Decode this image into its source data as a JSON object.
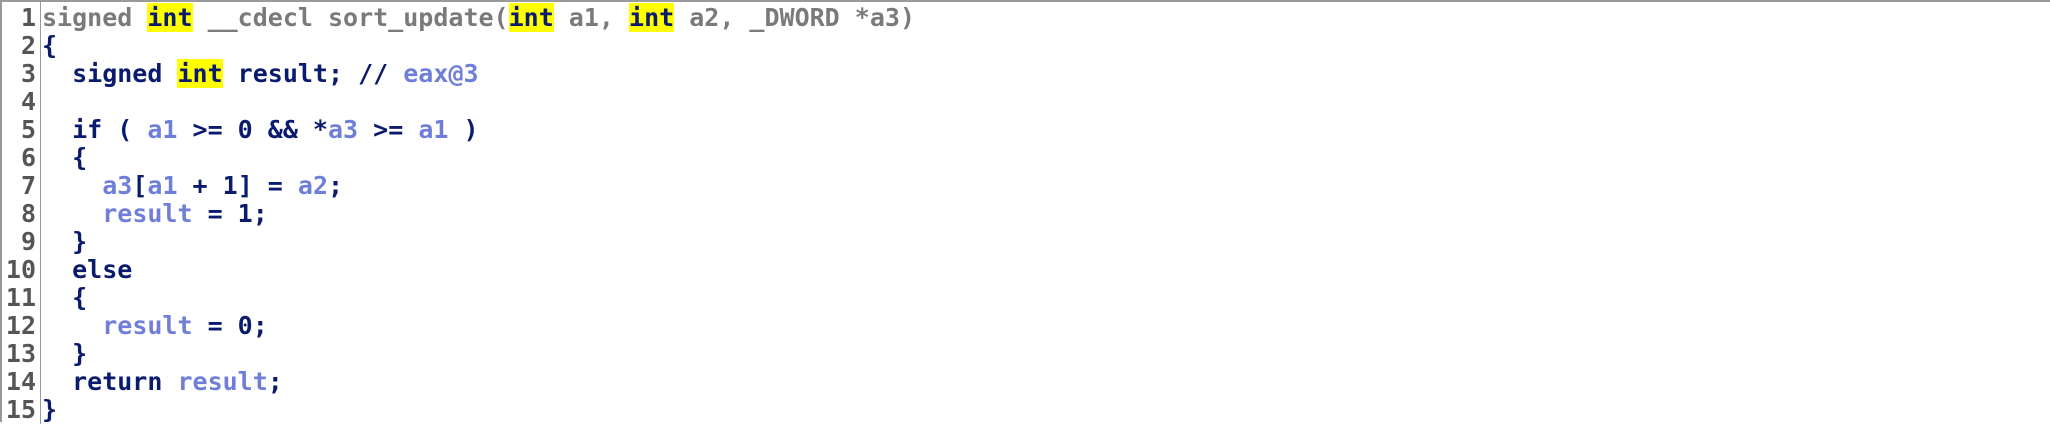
{
  "colors": {
    "background": "#ffffff",
    "line_number": "#555555",
    "keyword": "#0a1b6e",
    "variable": "#6f7fd9",
    "signature_text": "#7a7a7a",
    "highlight": "#ffff00"
  },
  "lines": [
    {
      "number": "1",
      "tokens": [
        {
          "text": "signed ",
          "style": "grey"
        },
        {
          "text": "int",
          "style": "hl"
        },
        {
          "text": " __cdecl sort_update(",
          "style": "grey"
        },
        {
          "text": "int",
          "style": "hl"
        },
        {
          "text": " a1, ",
          "style": "grey"
        },
        {
          "text": "int",
          "style": "hl"
        },
        {
          "text": " a2, _DWORD *a3)",
          "style": "grey"
        }
      ]
    },
    {
      "number": "2",
      "tokens": [
        {
          "text": "{",
          "style": "navy"
        }
      ]
    },
    {
      "number": "3",
      "tokens": [
        {
          "text": "  signed ",
          "style": "navy"
        },
        {
          "text": "int",
          "style": "hl"
        },
        {
          "text": " result; // ",
          "style": "navy"
        },
        {
          "text": "eax@3",
          "style": "var"
        }
      ]
    },
    {
      "number": "4",
      "tokens": []
    },
    {
      "number": "5",
      "tokens": [
        {
          "text": "  if ( ",
          "style": "navy"
        },
        {
          "text": "a1",
          "style": "var"
        },
        {
          "text": " >= 0 && *",
          "style": "navy"
        },
        {
          "text": "a3",
          "style": "var"
        },
        {
          "text": " >= ",
          "style": "navy"
        },
        {
          "text": "a1",
          "style": "var"
        },
        {
          "text": " )",
          "style": "navy"
        }
      ]
    },
    {
      "number": "6",
      "tokens": [
        {
          "text": "  {",
          "style": "navy"
        }
      ]
    },
    {
      "number": "7",
      "tokens": [
        {
          "text": "    ",
          "style": "navy"
        },
        {
          "text": "a3",
          "style": "var"
        },
        {
          "text": "[",
          "style": "navy"
        },
        {
          "text": "a1",
          "style": "var"
        },
        {
          "text": " + 1] = ",
          "style": "navy"
        },
        {
          "text": "a2",
          "style": "var"
        },
        {
          "text": ";",
          "style": "navy"
        }
      ]
    },
    {
      "number": "8",
      "tokens": [
        {
          "text": "    ",
          "style": "navy"
        },
        {
          "text": "result",
          "style": "var"
        },
        {
          "text": " = 1;",
          "style": "navy"
        }
      ]
    },
    {
      "number": "9",
      "tokens": [
        {
          "text": "  }",
          "style": "navy"
        }
      ]
    },
    {
      "number": "10",
      "tokens": [
        {
          "text": "  else",
          "style": "navy"
        }
      ]
    },
    {
      "number": "11",
      "tokens": [
        {
          "text": "  {",
          "style": "navy"
        }
      ]
    },
    {
      "number": "12",
      "tokens": [
        {
          "text": "    ",
          "style": "navy"
        },
        {
          "text": "result",
          "style": "var"
        },
        {
          "text": " = 0;",
          "style": "navy"
        }
      ]
    },
    {
      "number": "13",
      "tokens": [
        {
          "text": "  }",
          "style": "navy"
        }
      ]
    },
    {
      "number": "14",
      "tokens": [
        {
          "text": "  return ",
          "style": "navy"
        },
        {
          "text": "result",
          "style": "var"
        },
        {
          "text": ";",
          "style": "navy"
        }
      ]
    },
    {
      "number": "15",
      "tokens": [
        {
          "text": "}",
          "style": "navy"
        }
      ]
    }
  ]
}
